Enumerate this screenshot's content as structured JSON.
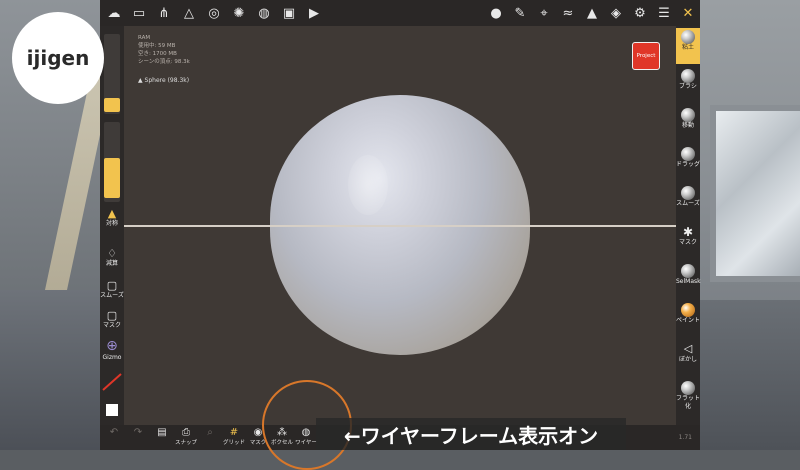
{
  "logo": {
    "text": "ijigen"
  },
  "stats": {
    "ram": "RAM",
    "used": "使用中: 59 MB",
    "free": "空き: 1700 MB",
    "vertices": "シーンの頂点: 98.3k",
    "mesh_name": "Sphere (98.3k)"
  },
  "project_button": "Project",
  "left_tools": [
    {
      "label": "対称",
      "icon": "symmetry-icon"
    },
    {
      "label": "減算",
      "icon": "subtract-drop-icon"
    },
    {
      "label": "スムーズ",
      "icon": "smooth-square-icon"
    },
    {
      "label": "マスク",
      "icon": "mask-square-icon"
    },
    {
      "label": "Gizmo",
      "icon": "gizmo-icon"
    }
  ],
  "right_tools": [
    {
      "label": "粘土",
      "active": true
    },
    {
      "label": "ブラシ",
      "active": false
    },
    {
      "label": "移動",
      "active": false
    },
    {
      "label": "ドラッグ",
      "active": false
    },
    {
      "label": "スムーズ",
      "active": false
    },
    {
      "label": "マスク",
      "active": false
    },
    {
      "label": "SelMask",
      "active": false
    },
    {
      "label": "ペイント",
      "active": false
    },
    {
      "label": "ぼかし",
      "active": false
    },
    {
      "label": "フラット化",
      "active": false
    }
  ],
  "bottom_tools": [
    {
      "label": "",
      "icon": "undo-icon"
    },
    {
      "label": "",
      "icon": "redo-icon"
    },
    {
      "label": "",
      "icon": "stack-icon"
    },
    {
      "label": "スナップ",
      "icon": "camera-icon"
    },
    {
      "label": "",
      "icon": "zoom-icon"
    },
    {
      "label": "グリッド",
      "icon": "grid-icon"
    },
    {
      "label": "マスク",
      "icon": "eye-icon"
    },
    {
      "label": "ボクセル",
      "icon": "voxel-icon"
    },
    {
      "label": "ワイヤー",
      "icon": "wireframe-icon"
    }
  ],
  "caption": "←ワイヤーフレーム表示オン",
  "version": "1.71",
  "colors": {
    "accent": "#f2c34e",
    "project": "#e03628",
    "highlight_circle": "#d8772a"
  }
}
